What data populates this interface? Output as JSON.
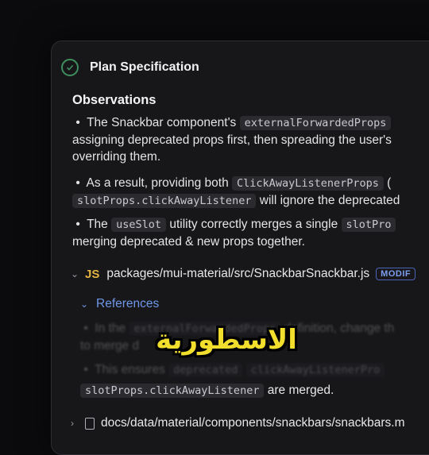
{
  "header": {
    "title": "Plan Specification"
  },
  "observations": {
    "heading": "Observations",
    "bullet": "•",
    "p1_l1_pre": "The Snackbar component's ",
    "p1_l1_code": "externalForwardedProps",
    "p1_l2": "assigning deprecated props first, then spreading the user's",
    "p1_l3": "overriding them.",
    "p2_l1_pre": "As a result, providing both ",
    "p2_l1_code": "ClickAwayListenerProps",
    "p2_l1_post": " (",
    "p2_l2_code": "slotProps.clickAwayListener",
    "p2_l2_post": " will ignore the deprecated",
    "p3_l1_pre": "The ",
    "p3_l1_code": "useSlot",
    "p3_l1_mid": " utility correctly merges a single ",
    "p3_l1_code2": "slotPro",
    "p3_l2": "merging deprecated & new props together."
  },
  "file1": {
    "lang": "JS",
    "path": "packages/mui-material/src/SnackbarSnackbar.js",
    "badge": "MODIF"
  },
  "references": {
    "label": "References",
    "r1_pre": "In the ",
    "r1_code": "externalForwardedProps",
    "r1_post": " definition, change th",
    "r1_l2": "to merge d",
    "r2_pre": "This ensures ",
    "r2_code": "deprecated",
    "r2_code2": "clickAwayListenerPro",
    "last_code": "slotProps.clickAwayListener",
    "last_post": " are merged."
  },
  "file2": {
    "path": "docs/data/material/components/snackbars/snackbars.m"
  },
  "overlay": {
    "caption": "الاسطورية"
  },
  "colors": {
    "accent": "#6f97e8",
    "js": "#e3b341",
    "caption": "#f2de2c",
    "check": "#3f8f5f"
  }
}
